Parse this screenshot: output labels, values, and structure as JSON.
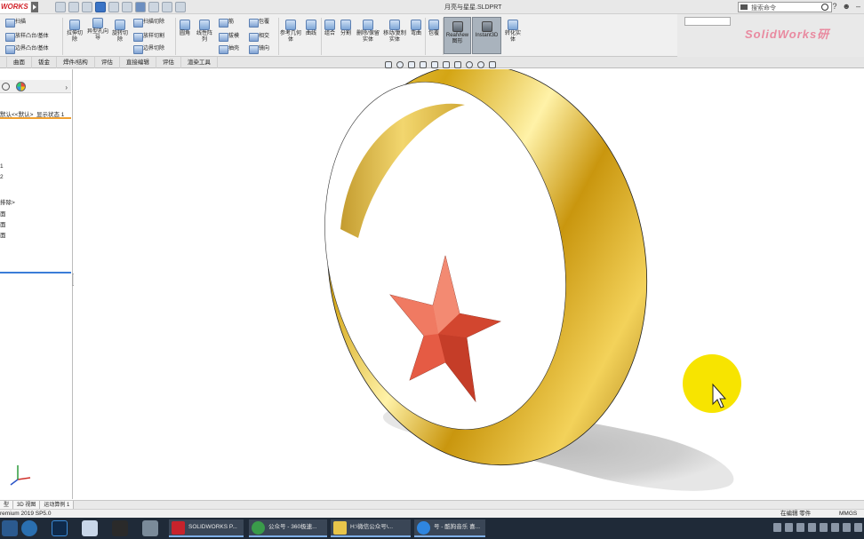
{
  "app": {
    "logo_text": "WORKS",
    "document_title": "月亮与星星.SLDPRT",
    "search_placeholder": "搜索命令",
    "watermark": "SolidWorks研"
  },
  "ribbon": {
    "small_items": [
      "扫描",
      "放样凸台/基体",
      "边界凸台/基体",
      "扫描切除",
      "放样切割",
      "边界切除",
      "筋",
      "拔模",
      "抽壳",
      "包覆",
      "相交",
      "镜向"
    ],
    "buttons": [
      "拉伸切除",
      "异型孔向导",
      "旋转切除",
      "圆角",
      "线性阵列",
      "参考几何体",
      "曲线",
      "组合",
      "分割",
      "删除/保留实体",
      "移动/复制实体",
      "弯曲",
      "包覆",
      "RealView图形",
      "Instant3D",
      "转化实体"
    ]
  },
  "tabs": [
    "曲面",
    "钣金",
    "焊件/结构",
    "评估",
    "直接编辑",
    "评估",
    "渲染工具"
  ],
  "left_panel": {
    "config_line": "默认<<默认>_显示状态 1",
    "items": [
      "1",
      "2",
      "排除>",
      "面",
      "面",
      "面"
    ]
  },
  "bottom_tabs": [
    "型",
    "3D 视图",
    "运动算例 1"
  ],
  "status": {
    "version": "remium 2019 SP5.0",
    "mode": "在编辑 零件",
    "units": "MMGS"
  },
  "taskbar": {
    "tasks": [
      "SOLIDWORKS P...",
      "公众号 - 360极速...",
      "H:\\微信公众号\\...",
      "号 - 酷狗音乐 喜..."
    ]
  },
  "colors": {
    "ring_gold": "#e0b21c",
    "star_red": "#e8604a",
    "cursor_highlight": "#f7e400",
    "taskbar_bg": "#1f2a38"
  }
}
